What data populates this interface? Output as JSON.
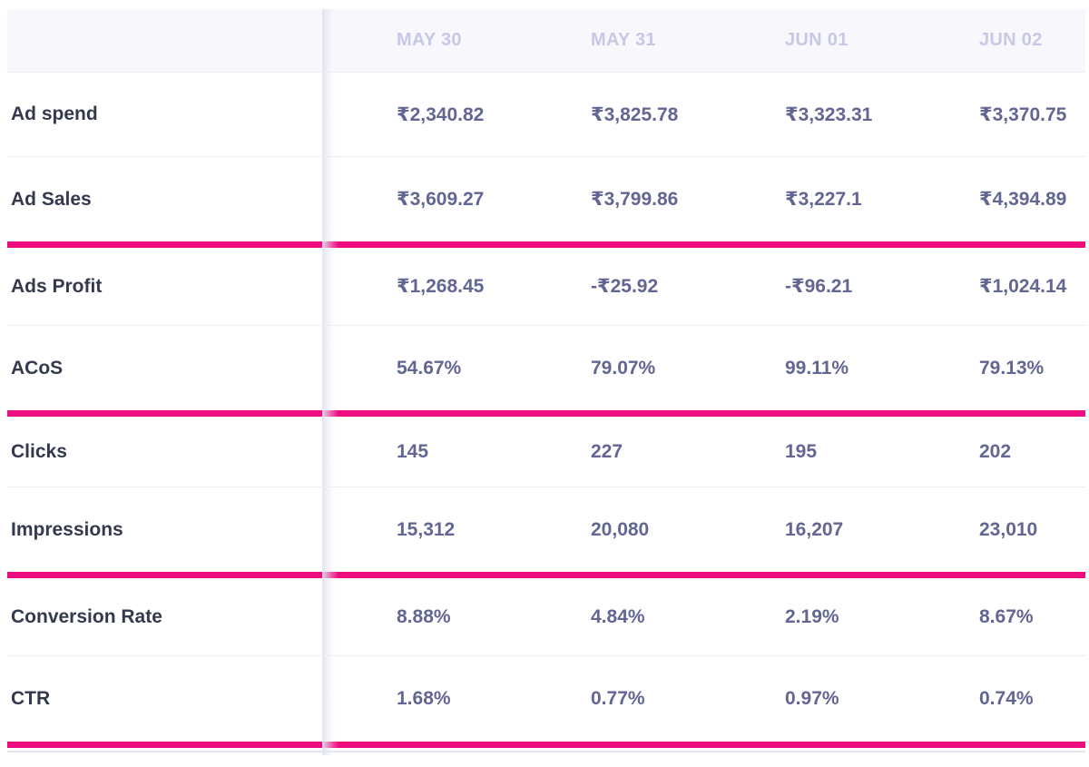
{
  "columns": [
    "MAY 30",
    "MAY 31",
    "JUN 01",
    "JUN 02"
  ],
  "groups": [
    {
      "rows": [
        {
          "label": "Ad spend",
          "values": [
            "₹2,340.82",
            "₹3,825.78",
            "₹3,323.31",
            "₹3,370.75"
          ]
        },
        {
          "label": "Ad Sales",
          "values": [
            "₹3,609.27",
            "₹3,799.86",
            "₹3,227.1",
            "₹4,394.89"
          ]
        }
      ]
    },
    {
      "rows": [
        {
          "label": "Ads Profit",
          "values": [
            "₹1,268.45",
            "-₹25.92",
            "-₹96.21",
            "₹1,024.14"
          ]
        },
        {
          "label": "ACoS",
          "values": [
            "54.67%",
            "79.07%",
            "99.11%",
            "79.13%"
          ]
        }
      ]
    },
    {
      "rows": [
        {
          "label": "Clicks",
          "values": [
            "145",
            "227",
            "195",
            "202"
          ]
        },
        {
          "label": "Impressions",
          "values": [
            "15,312",
            "20,080",
            "16,207",
            "23,010"
          ]
        }
      ]
    },
    {
      "rows": [
        {
          "label": "Conversion Rate",
          "values": [
            "8.88%",
            "4.84%",
            "2.19%",
            "8.67%"
          ]
        },
        {
          "label": "CTR",
          "values": [
            "1.68%",
            "0.77%",
            "0.97%",
            "0.74%"
          ]
        }
      ]
    }
  ],
  "colors": {
    "divider": "#ee0d7e",
    "label_text": "#333a4d",
    "value_text": "#626693",
    "header_text": "#c6c8e6"
  }
}
